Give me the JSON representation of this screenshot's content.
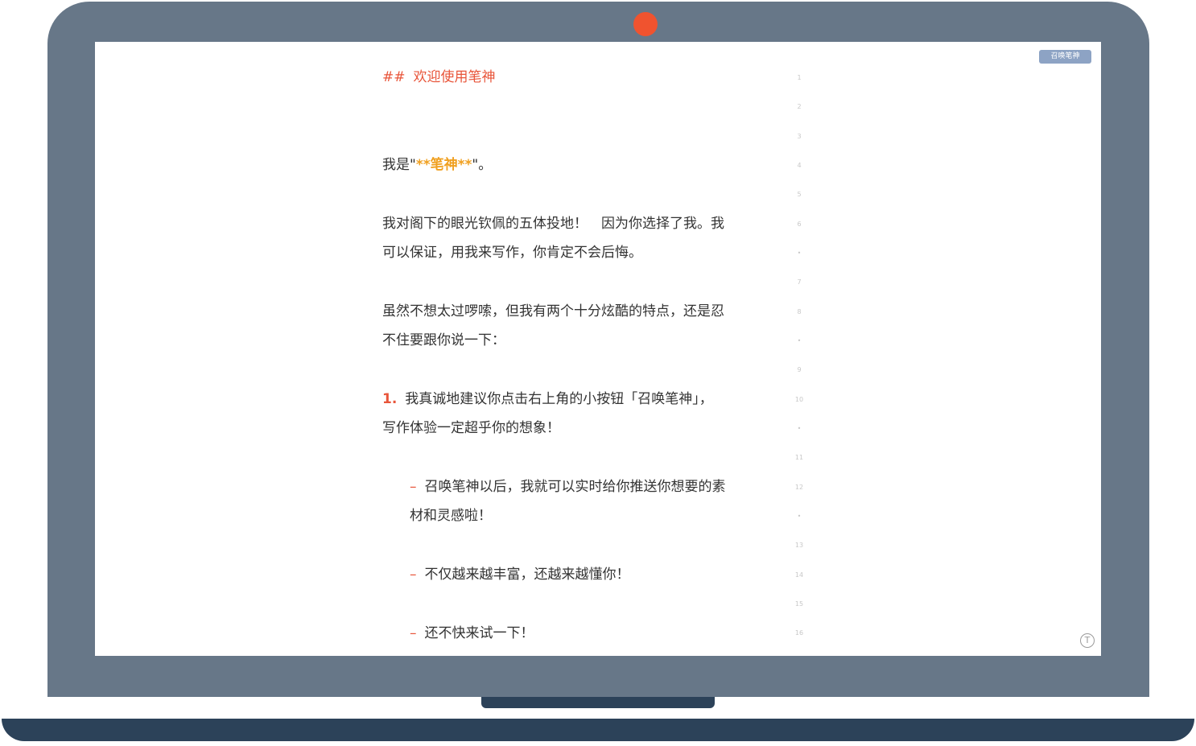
{
  "app": {
    "summon_button_label": "召唤笔神",
    "typewriter_icon": "typewriter-mode-icon",
    "accent_color": "#e8553a",
    "bold_color": "#f0a020",
    "bezel_color": "#677788",
    "webcam_color": "#f0532f"
  },
  "editor": {
    "heading_marker": "##",
    "heading_text": "欢迎使用笔神",
    "para1_prefix": "我是\"",
    "para1_bold": "**笔神**",
    "para1_suffix": "\"。",
    "para2_line1": "我对阁下的眼光钦佩的五体投地！　因为你选择了我。我",
    "para2_line2": "可以保证，用我来写作，你肯定不会后悔。",
    "para3_line1": "虽然不想太过啰嗦，但我有两个十分炫酷的特点，还是忍",
    "para3_line2": "不住要跟你说一下：",
    "list1_marker": "1.",
    "list1_line1": "我真诚地建议你点击右上角的小按钮「召唤笔神」，",
    "list1_line2": "写作体验一定超乎你的想象！",
    "bullet_marker": "–",
    "bullet1_line1": "召唤笔神以后，我就可以实时给你推送你想要的素",
    "bullet1_line2": "材和灵感啦！",
    "bullet2": "不仅越来越丰富，还越来越懂你！",
    "bullet3": "还不快来试一下！"
  },
  "gutter": {
    "line_numbers": [
      "1",
      "2",
      "3",
      "4",
      "5",
      "6",
      "•",
      "7",
      "8",
      "•",
      "9",
      "10",
      "•",
      "11",
      "12",
      "•",
      "13",
      "14",
      "15",
      "16"
    ]
  }
}
